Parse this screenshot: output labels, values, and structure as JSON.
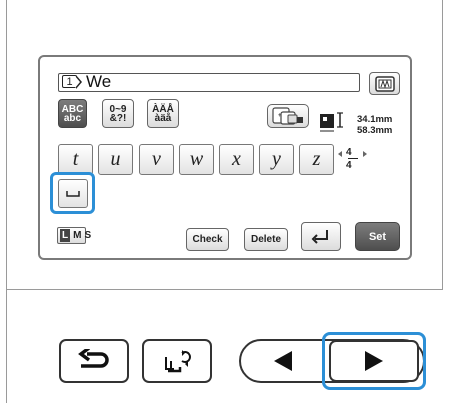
{
  "screen": {
    "text_field": {
      "line_number": "1",
      "text": "We"
    },
    "categories": [
      {
        "icon": "abc-case-icon",
        "line1": "ABC",
        "line2": "abc"
      },
      {
        "icon": "number-symbol-icon",
        "line1": "0~9",
        "line2": "&?!"
      },
      {
        "icon": "accented-letters-icon",
        "line1": "ÀÄÅ",
        "line2": "àäå"
      }
    ],
    "dimensions": {
      "width": "34.1mm",
      "height": "58.3mm"
    },
    "keys": [
      "t",
      "u",
      "v",
      "w",
      "x",
      "y",
      "z"
    ],
    "page": {
      "current": "4",
      "total": "4"
    },
    "size_options": [
      "L",
      "M",
      "S"
    ],
    "selected_size": "L",
    "buttons": {
      "check": "Check",
      "delete": "Delete",
      "set": "Set"
    }
  },
  "colors": {
    "highlight": "#2c8fd6",
    "dark_button": "#555555"
  },
  "bottom_nav": {
    "icons": [
      "return-icon",
      "needle-reload-icon",
      "left-arrow-icon",
      "right-arrow-icon"
    ]
  }
}
